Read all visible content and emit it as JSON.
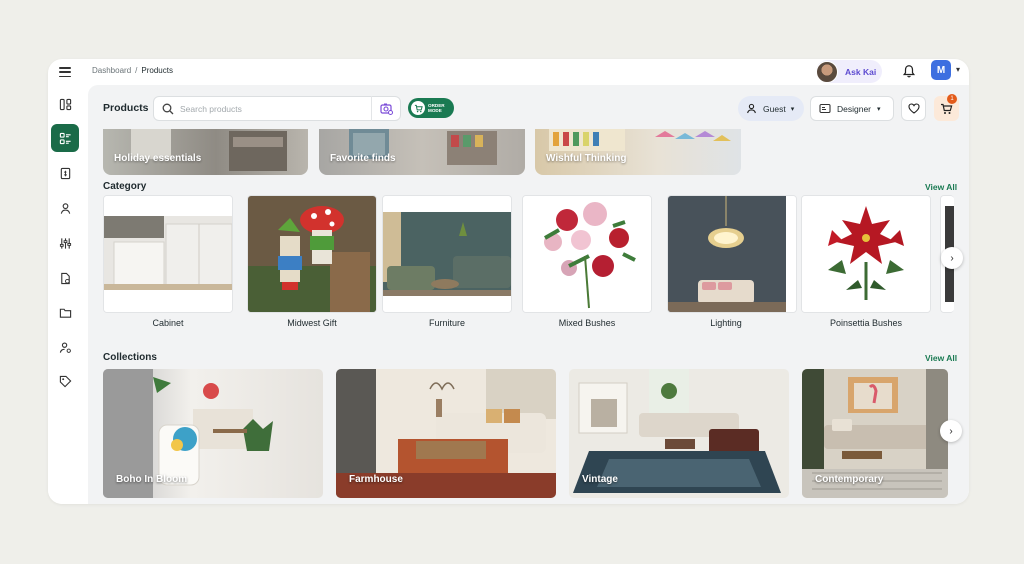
{
  "breadcrumb": {
    "root": "Dashboard",
    "separator": "/",
    "current": "Products"
  },
  "header": {
    "assistant_label": "Ask Kai",
    "user_initial": "M"
  },
  "toolbar": {
    "title": "Products",
    "search_placeholder": "Search products",
    "order_mode_line1": "ORDER",
    "order_mode_line2": "MODE",
    "guest_label": "Guest",
    "designer_label": "Designer",
    "cart_count": "1"
  },
  "promos": [
    {
      "label": "Holiday essentials"
    },
    {
      "label": "Favorite finds"
    },
    {
      "label": "Wishful Thinking"
    }
  ],
  "category": {
    "title": "Category",
    "view_all": "View All",
    "items": [
      {
        "label": "Cabinet"
      },
      {
        "label": "Midwest Gift"
      },
      {
        "label": "Furniture"
      },
      {
        "label": "Mixed Bushes"
      },
      {
        "label": "Lighting"
      },
      {
        "label": "Poinsettia Bushes"
      }
    ]
  },
  "collections": {
    "title": "Collections",
    "view_all": "View All",
    "items": [
      {
        "label": "Boho In Bloom"
      },
      {
        "label": "Farmhouse"
      },
      {
        "label": "Vintage"
      },
      {
        "label": "Contemporary"
      }
    ]
  },
  "colors": {
    "brand_green": "#1a6b48",
    "accent_green": "#1a7a52",
    "cart_badge": "#e35b1b",
    "avatar_blue": "#3d6fe0"
  }
}
